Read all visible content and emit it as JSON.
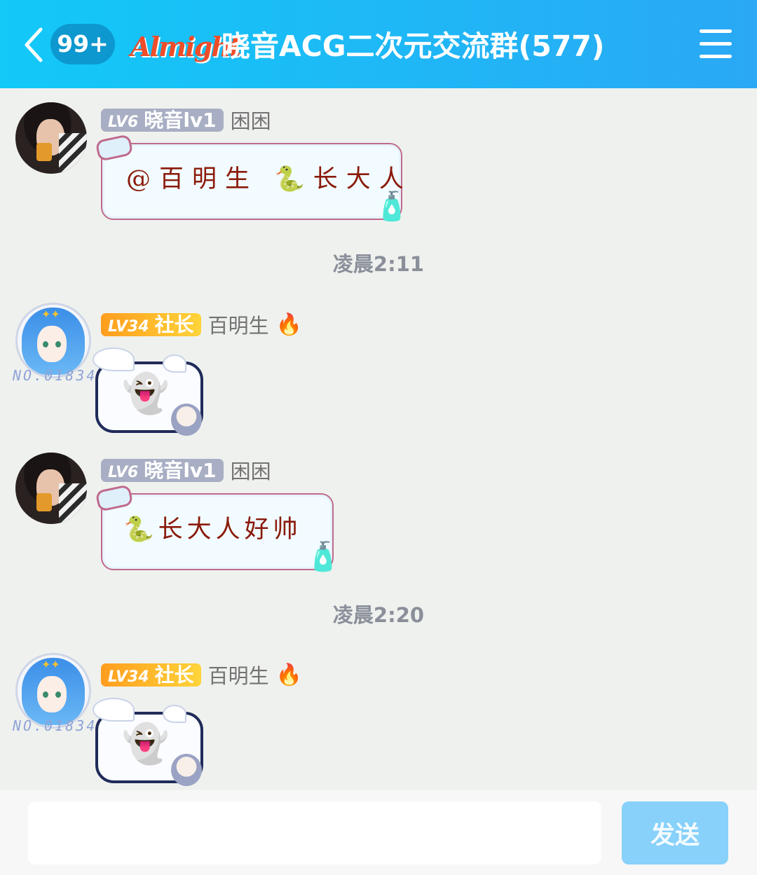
{
  "header": {
    "unread_count": "99+",
    "logo_text": "Almight",
    "title": "晓音ACG二次元交流群(577)"
  },
  "messages": [
    {
      "sender": {
        "level": "LV6",
        "title": "晓音lv1",
        "nickname": "困困"
      },
      "text": "@百明生 🐍长大人",
      "bubble": "notebook"
    },
    {
      "sender": {
        "level": "LV34",
        "title": "社长",
        "nickname": "百明生",
        "badge_icon": "🔥",
        "frame_text": "NO.01834"
      },
      "text": "👻",
      "bubble": "ghost"
    },
    {
      "sender": {
        "level": "LV6",
        "title": "晓音lv1",
        "nickname": "困困"
      },
      "text": "🐍长大人好帅",
      "bubble": "notebook"
    },
    {
      "sender": {
        "level": "LV34",
        "title": "社长",
        "nickname": "百明生",
        "badge_icon": "🔥",
        "frame_text": "NO.01834"
      },
      "text": "👻",
      "bubble": "ghost"
    }
  ],
  "timestamps": [
    "凌晨2:11",
    "凌晨2:20"
  ],
  "input": {
    "value": "",
    "send_label": "发送"
  },
  "colors": {
    "header_gradient_start": "#12c9f8",
    "header_gradient_end": "#2aa8f4",
    "background": "#eff1ee",
    "send_button": "#87d1fb",
    "badge_gray": "#a8aec3",
    "badge_gold": "#ffb42a"
  }
}
